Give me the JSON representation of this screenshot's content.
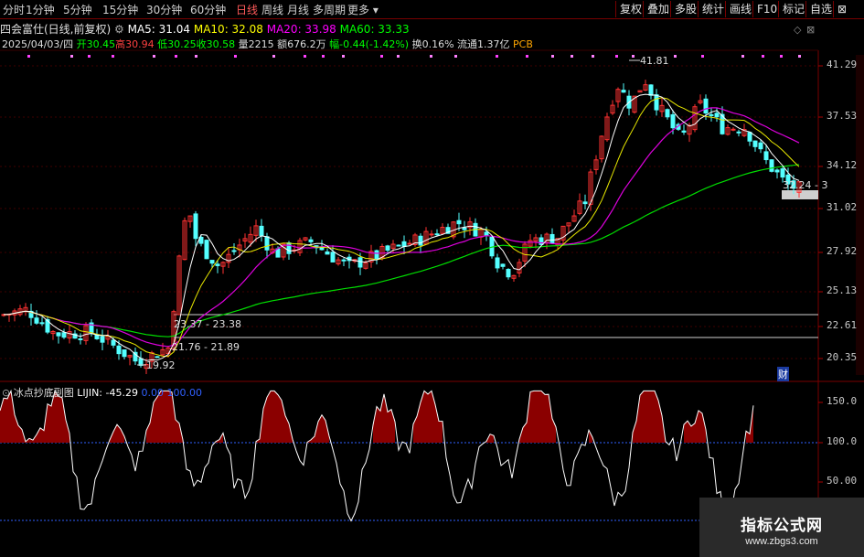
{
  "toolbar": {
    "periods": [
      "分时",
      "1分钟",
      "5分钟",
      "15分钟",
      "30分钟",
      "60分钟",
      "日线",
      "周线",
      "月线",
      "多周期",
      "更多"
    ],
    "active_period": "日线",
    "right_buttons": [
      "复权",
      "叠加",
      "多股",
      "统计",
      "画线",
      "F10",
      "标记",
      "自选"
    ]
  },
  "title": {
    "stock": "四会富仕(日线,前复权)",
    "ma5": "MA5: 31.04",
    "ma10": "MA10: 32.08",
    "ma20": "MA20: 33.98",
    "ma60": "MA60: 33.33"
  },
  "ohlc": {
    "date": "2025/04/03/四",
    "open": "开30.45",
    "high": "高30.94",
    "low": "低30.25",
    "close": "收30.58",
    "volume": "量2215",
    "amount": "额676.2万",
    "change": "幅-0.44(-1.42%)",
    "turnover": "换0.16%",
    "float": "流通1.37亿",
    "sector": "PCB"
  },
  "price_axis": [
    "41.29",
    "37.53",
    "34.12",
    "31.02",
    "27.92",
    "25.13",
    "22.61",
    "20.35"
  ],
  "annotations": {
    "high_label": "41.81",
    "low_label": "19.92",
    "box1": "23.37 - 23.38",
    "box2": "21.76 - 21.89",
    "box3": "32.24 - 3",
    "marker": "财"
  },
  "indicator": {
    "name": "冰点抄底副图",
    "value": "LIJIN: -45.29",
    "v1": "0.00",
    "v2": "100.00",
    "axis": [
      "150.0",
      "100.0",
      "50.00"
    ]
  },
  "watermark": {
    "main": "指标公式网",
    "sub": "www.zbgs3.com"
  },
  "colors": {
    "up": "#ff3232",
    "down": "#54ffff",
    "ma5": "#ffffff",
    "ma10": "#ffff00",
    "ma20": "#ff00ff",
    "ma60": "#00ff00",
    "fill_red": "#8b0000",
    "fill_green": "#007000"
  }
}
